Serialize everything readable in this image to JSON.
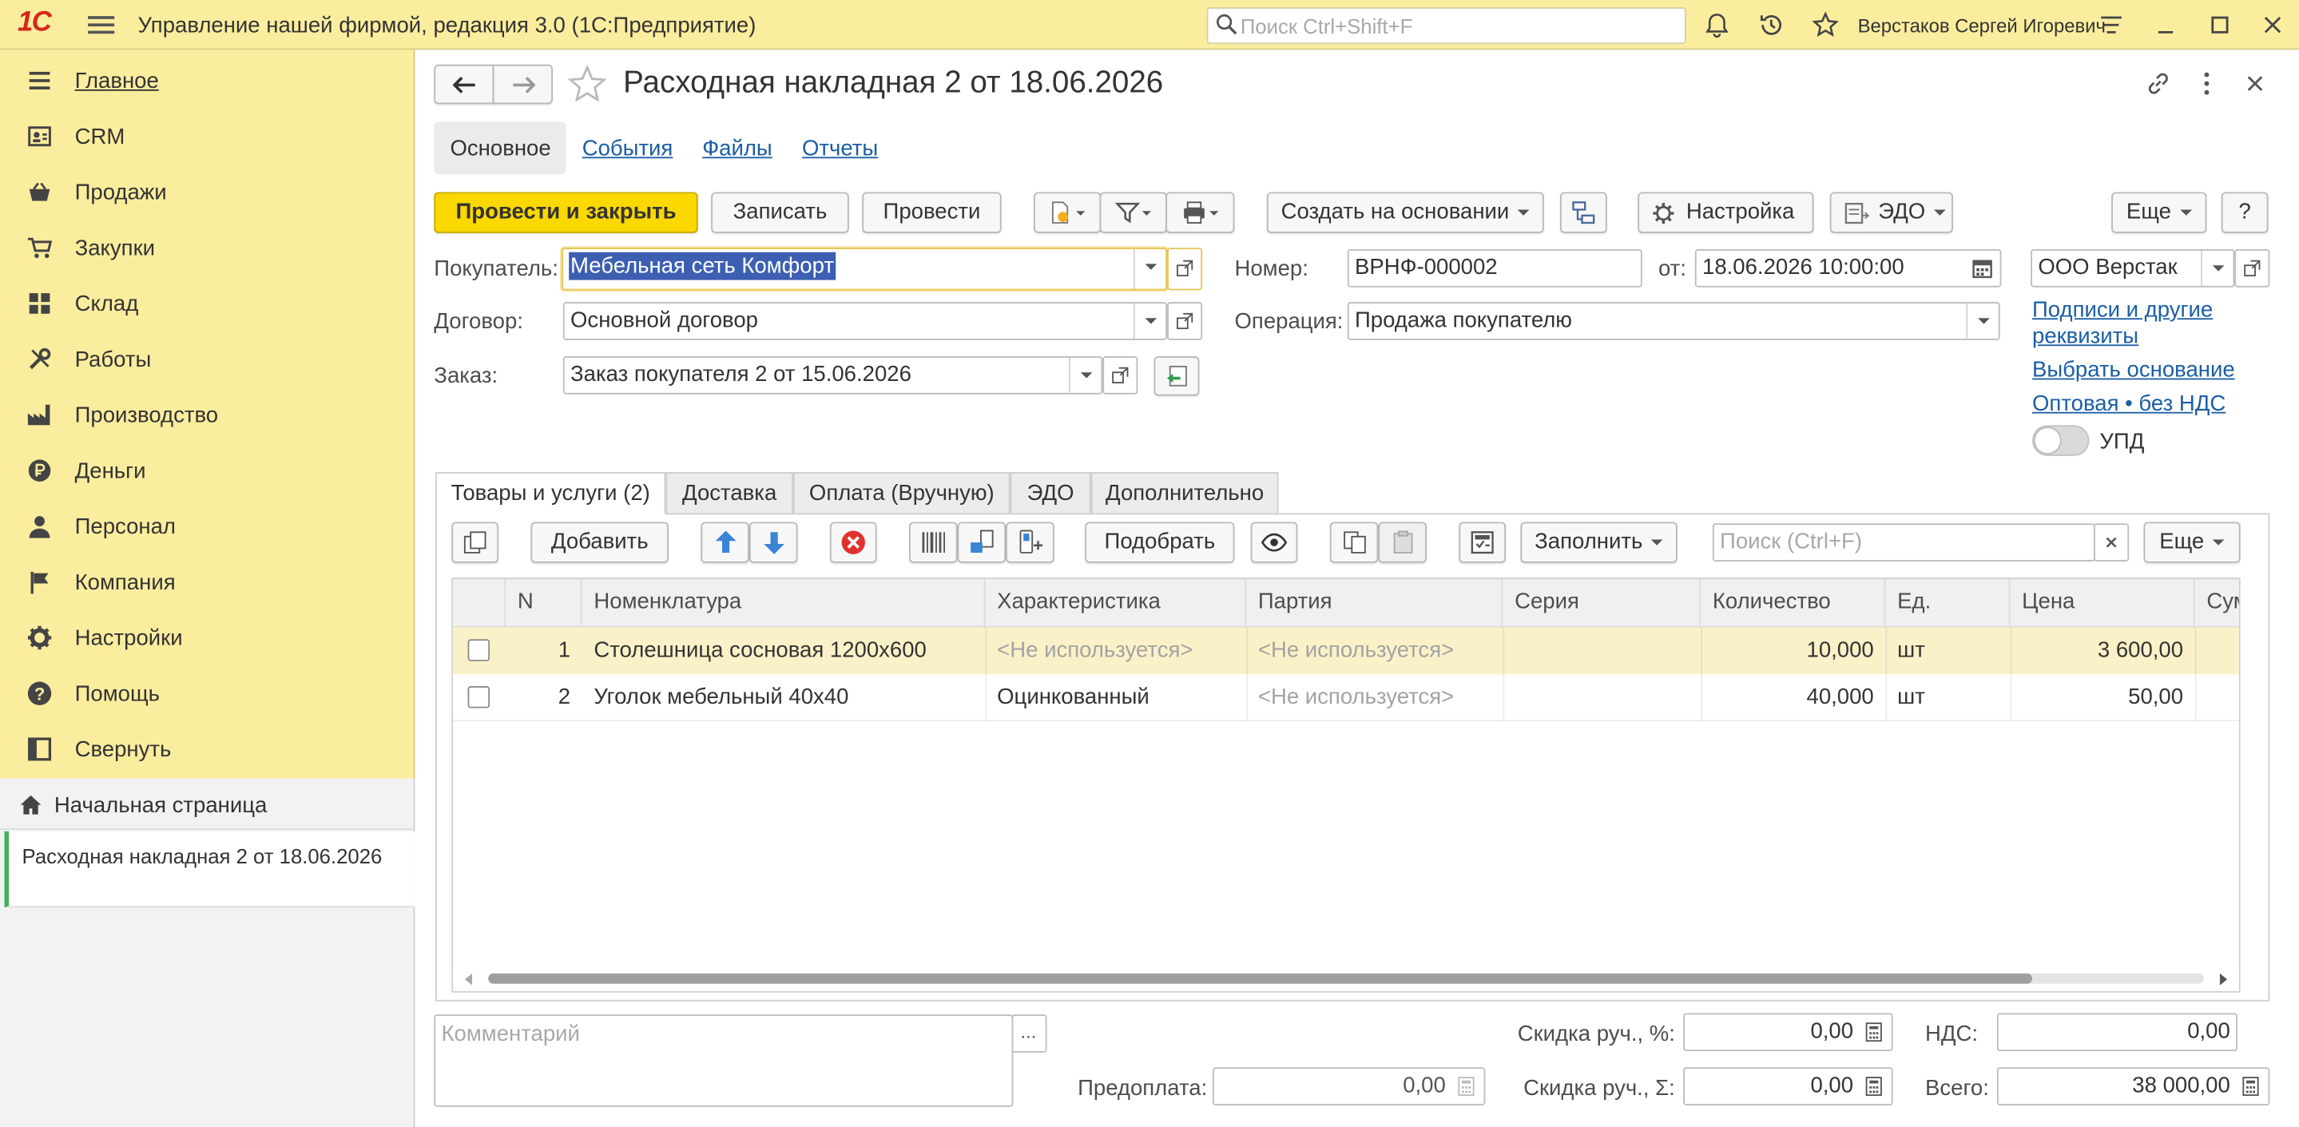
{
  "titlebar": {
    "app_title": "Управление нашей фирмой, редакция 3.0  (1С:Предприятие)",
    "search_placeholder": "Поиск Ctrl+Shift+F",
    "user_name": "Верстаков Сергей Игоревич"
  },
  "sidebar": {
    "items": [
      {
        "label": "Главное",
        "icon": "menu-list-icon"
      },
      {
        "label": "CRM",
        "icon": "contact-card-icon"
      },
      {
        "label": "Продажи",
        "icon": "shopping-basket-icon"
      },
      {
        "label": "Закупки",
        "icon": "cart-icon"
      },
      {
        "label": "Склад",
        "icon": "warehouse-grid-icon"
      },
      {
        "label": "Работы",
        "icon": "tools-icon"
      },
      {
        "label": "Производство",
        "icon": "factory-icon"
      },
      {
        "label": "Деньги",
        "icon": "ruble-coin-icon"
      },
      {
        "label": "Персонал",
        "icon": "person-icon"
      },
      {
        "label": "Компания",
        "icon": "flag-icon"
      },
      {
        "label": "Настройки",
        "icon": "gear-icon"
      },
      {
        "label": "Помощь",
        "icon": "help-icon"
      },
      {
        "label": "Свернуть",
        "icon": "collapse-panel-icon"
      }
    ],
    "start_page": "Начальная страница",
    "open_document": "Расходная накладная 2 от 18.06.2026"
  },
  "document": {
    "title": "Расходная накладная 2 от 18.06.2026",
    "nav_tabs": [
      "Основное",
      "События",
      "Файлы",
      "Отчеты"
    ],
    "toolbar": {
      "post_and_close": "Провести и закрыть",
      "save": "Записать",
      "post": "Провести",
      "create_based_on": "Создать на основании",
      "settings": "Настройка",
      "edo": "ЭДО",
      "more": "Еще",
      "help": "?"
    },
    "fields": {
      "buyer_label": "Покупатель:",
      "buyer_value": "Мебельная сеть Комфорт",
      "contract_label": "Договор:",
      "contract_value": "Основной договор",
      "order_label": "Заказ:",
      "order_value": "Заказ покупателя 2 от 15.06.2026",
      "number_label": "Номер:",
      "number_value": "ВРНФ-000002",
      "date_label": "от:",
      "date_value": "18.06.2026 10:00:00",
      "operation_label": "Операция:",
      "operation_value": "Продажа покупателю",
      "company_value": "ООО Верстак"
    },
    "right_links": {
      "signatures": "Подписи и другие реквизиты",
      "choose_basis": "Выбрать основание",
      "price_type": "Оптовая • без НДС",
      "upd_label": "УПД",
      "upd_on": false
    },
    "content_tabs": [
      "Товары и услуги (2)",
      "Доставка",
      "Оплата (Вручную)",
      "ЭДО",
      "Дополнительно"
    ],
    "table_toolbar": {
      "add": "Добавить",
      "pick": "Подобрать",
      "fill": "Заполнить",
      "search_placeholder": "Поиск (Ctrl+F)",
      "more": "Еще"
    },
    "table": {
      "columns": [
        "N",
        "Номенклатура",
        "Характеристика",
        "Партия",
        "Серия",
        "Количество",
        "Ед.",
        "Цена",
        "Сумма"
      ],
      "rows": [
        {
          "n": "1",
          "item": "Столешница сосновая 1200х600",
          "characteristic": "<Не используется>",
          "batch": "<Не используется>",
          "series": "",
          "qty": "10,000",
          "unit": "шт",
          "price": "3 600,00",
          "selected": true
        },
        {
          "n": "2",
          "item": "Уголок мебельный 40х40",
          "characteristic": "Оцинкованный",
          "batch": "<Не используется>",
          "series": "",
          "qty": "40,000",
          "unit": "шт",
          "price": "50,00",
          "selected": false
        }
      ]
    },
    "footer": {
      "comment_placeholder": "Комментарий",
      "discount_pct_label": "Скидка руч., %:",
      "discount_pct_value": "0,00",
      "discount_sum_label": "Скидка руч., Σ:",
      "discount_sum_value": "0,00",
      "prepay_label": "Предоплата:",
      "prepay_value": "0,00",
      "vat_label": "НДС:",
      "vat_value": "0,00",
      "total_label": "Всего:",
      "total_value": "38 000,00"
    }
  },
  "colors": {
    "panel_yellow": "#fbed9e",
    "primary_button": "#fad800",
    "link_blue": "#1b5ea5",
    "selected_row": "#fbf1c8",
    "active_doc_marker": "#3fb355"
  }
}
